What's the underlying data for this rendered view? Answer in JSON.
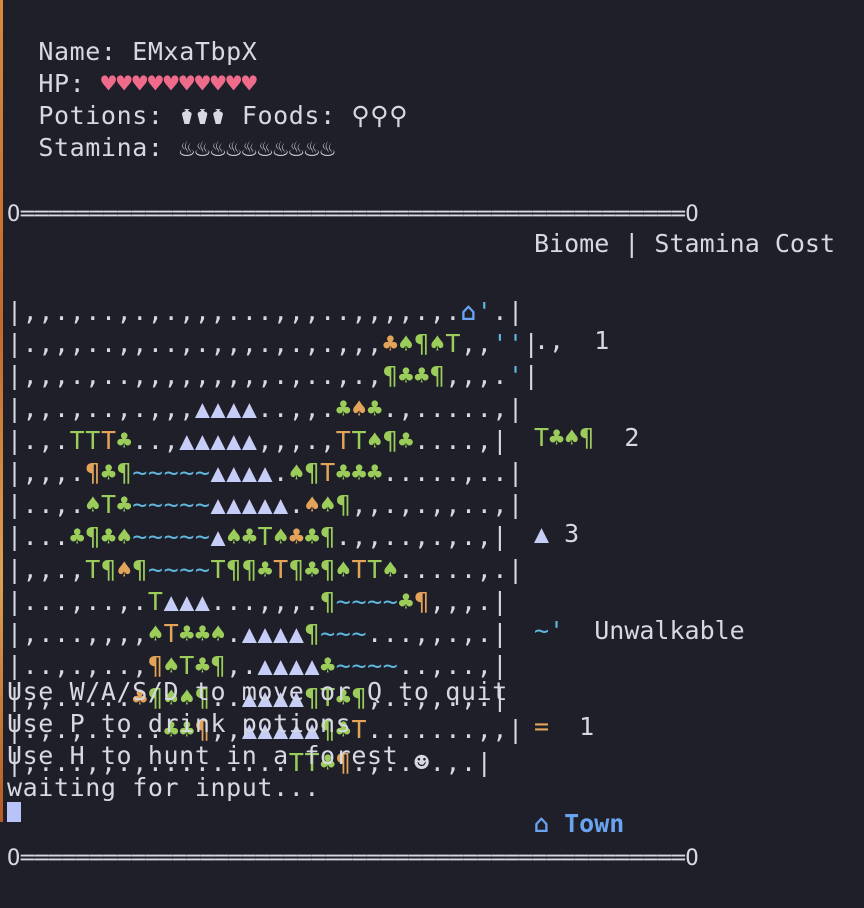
{
  "status": {
    "name_label": "Name:",
    "name": "EMxaTbpX",
    "hp_label": "HP:",
    "hp": "♥♥♥♥♥♥♥♥♥♥",
    "potions_label": "Potions:",
    "potions": "⚱⚱⚱",
    "foods_label": "Foods:",
    "foods": "⚲⚲⚲",
    "stamina_label": "Stamina:",
    "stamina": "♨♨♨♨♨♨♨♨♨♨"
  },
  "map": {
    "top_border": "O════════════════════════════════════════════════O",
    "bottom_border": "O════════════════════════════════════════════════O",
    "rows": [
      "|,,.,..,.,.,,,...,,,..,,,,.,.⌂'.|",
      "|.,,,..,,..,.,,,.,.,.,,,♣♠¶♠T,,''|",
      "|,,,.,..,,,,,,,,,.,..,.,¶♣♣¶,,,.'|",
      "|,,.,..,.,,,▲▲▲▲..,,.♣♠♣.,.....,|",
      "|.,.TTT♣..,▲▲▲▲▲,,,.,TT♠¶♣....,|",
      "|,,,.¶♣¶~~~~~▲▲▲▲.♠¶T♣♣♣.....,..|",
      "|..,.♠T♣~~~~~▲▲▲▲▲.♠♠¶,,.,.,,..,|",
      "|...♣¶♣♠~~~~~▲♠♣T♠♣♣¶.,,..,.,.,|",
      "|,,.,T¶♠¶~~~~T¶¶♣T¶♣¶♠TT♠.....,.|",
      "|...,..,.T▲▲▲...,,,.¶~~~~♣¶,,,.|",
      "|,...,,,,♠T♣♣♠.▲▲▲▲¶~~~...,,.,.|",
      "|..,.,..,¶♠T♣¶,.▲▲▲▲♣~~~~..,..,|",
      "|,,.....♣¶♠♠¶..▲▲▲▲¶T♣¶,..,,.,.|",
      "|.,.,.....♣♣¶,,▲▲▲▲▲¶♣T.......,,|",
      "|,...,,.,.........TT♣¶.,..☻.,.|"
    ]
  },
  "legend": {
    "header": "Biome | Stamina Cost",
    "rows": [
      {
        "symbol": ".,",
        "cost": "1"
      },
      {
        "symbol": "T♣♠¶",
        "cost": "2"
      },
      {
        "symbol": "▲",
        "cost": "3"
      },
      {
        "symbol": "~'",
        "cost": "Unwalkable"
      },
      {
        "symbol": "=",
        "cost": "1"
      },
      {
        "symbol": "⌂",
        "cost": "Town"
      }
    ]
  },
  "help": {
    "move": "Use W/A/S/D to move or Q to quit",
    "potions": "Use P to drink potions",
    "hunt": "Use H to hunt in a forest",
    "status": "waiting for input..."
  },
  "colors": {
    "background": "#1e1f29",
    "text": "#d6d8e2",
    "hp": "#ef6b8c",
    "forest": "#9ccd5b",
    "forest_alt": "#e3a45a",
    "mountain": "#c6cdf6",
    "water": "#5fb8e0",
    "town": "#6aa4f0"
  }
}
